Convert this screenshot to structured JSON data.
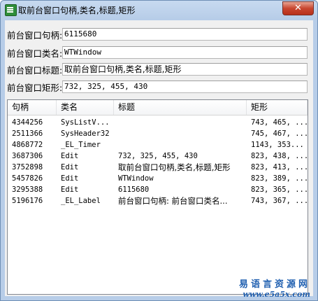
{
  "window": {
    "title": "取前台窗口句柄,类名,标题,矩形",
    "close_label": "✕"
  },
  "fields": [
    {
      "label": "前台窗口句柄:",
      "value": "6115680"
    },
    {
      "label": "前台窗口类名:",
      "value": "WTWindow"
    },
    {
      "label": "前台窗口标题:",
      "value": "取前台窗口句柄,类名,标题,矩形"
    },
    {
      "label": "前台窗口矩形:",
      "value": "732, 325, 455, 430"
    }
  ],
  "list": {
    "columns": [
      "句柄",
      "类名",
      "标题",
      "矩形"
    ],
    "rows": [
      [
        "4344256",
        "SysListV...",
        "",
        "743, 465, ..."
      ],
      [
        "2511366",
        "SysHeader32",
        "",
        "745, 467, ..."
      ],
      [
        "4868772",
        "_EL_Timer",
        "",
        "1143, 353..."
      ],
      [
        "3687306",
        "Edit",
        "732, 325, 455, 430",
        "823, 438, ..."
      ],
      [
        "3752898",
        "Edit",
        "取前台窗口句柄,类名,标题,矩形",
        "823, 413, ..."
      ],
      [
        "5457826",
        "Edit",
        "WTWindow",
        "823, 389, ..."
      ],
      [
        "3295388",
        "Edit",
        "6115680",
        "823, 365, ..."
      ],
      [
        "5196176",
        "_EL_Label",
        "前台窗口句柄: 前台窗口类名...",
        "743, 367, ..."
      ]
    ]
  },
  "watermark": {
    "cn": "易语言资源网",
    "url": "www.e5a5x.com"
  }
}
